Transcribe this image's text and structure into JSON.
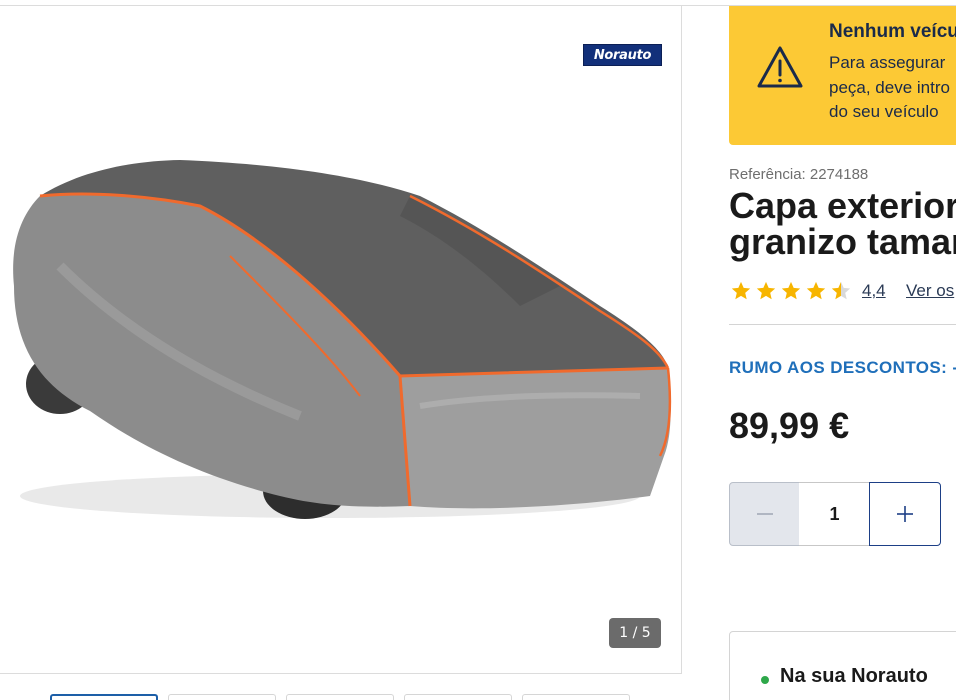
{
  "gallery": {
    "brand_logo": "Norauto",
    "image_alt": "Capa exterior granizo",
    "counter": "1 / 5",
    "thumbnails": 5
  },
  "vehicle_alert": {
    "title": "Nenhum veícu",
    "lines": [
      "Para assegurar",
      "peça, deve intro",
      "do seu veículo"
    ],
    "icon": "warning-triangle-icon",
    "color": "#fcc935"
  },
  "product": {
    "reference": "Referência: 2274188",
    "title_line1": "Capa exterior",
    "title_line2": "granizo taman",
    "rating": 4.4,
    "rating_label": "4,4",
    "reviews_link": "Ver os",
    "promo": "RUMO AOS DESCONTOS: -",
    "price": "89,99 €",
    "quantity": "1"
  },
  "store": {
    "label": "Na sua Norauto",
    "status_color": "#2ea84a"
  },
  "colors": {
    "accent_blue": "#1f6fba",
    "button_navy": "#1d3f86",
    "star": "#f7b500"
  }
}
